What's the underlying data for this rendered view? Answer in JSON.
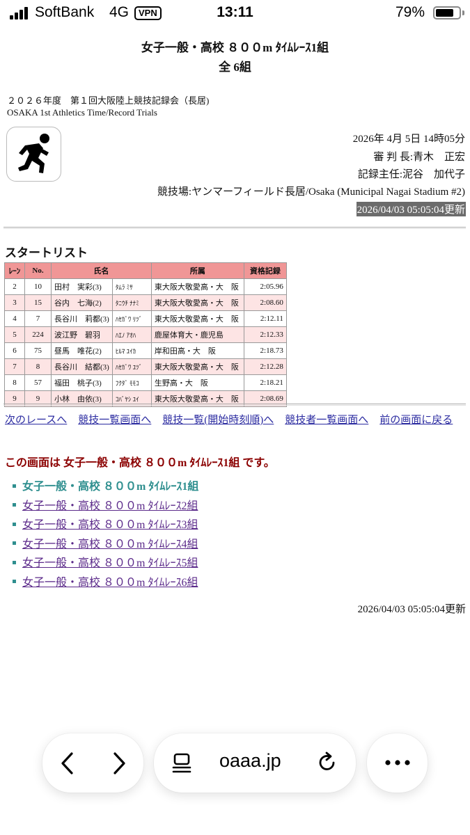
{
  "status_bar": {
    "carrier": "SoftBank",
    "network": "4G",
    "vpn": "VPN",
    "time": "13:11",
    "battery_percent": "79%",
    "battery_level": 0.79
  },
  "header": {
    "title": "女子一般・高校 ８００m ﾀｲﾑﾚｰｽ1組",
    "subtitle": "全 6組",
    "meet_name": "２０２６年度　第１回大阪陸上競技記録会（長居)",
    "meet_name_en": "OSAKA 1st Athletics Time/Record Trials"
  },
  "info": {
    "datetime": "2026年 4月 5日 14時05分",
    "referee": "審 判 長:青木　正宏",
    "recorder": "記録主任:泥谷　加代子",
    "venue": "競技場:ヤンマーフィールド長居/Osaka (Municipal Nagai Stadium #2)",
    "updated": "2026/04/03 05:05:04更新"
  },
  "section_title": "スタートリスト",
  "table": {
    "headers": {
      "lane": "ﾚｰﾝ",
      "no": "No.",
      "name": "氏名",
      "team": "所属",
      "record": "資格記録"
    },
    "rows": [
      {
        "lane": "2",
        "no": "10",
        "name": "田村　実彩(3)",
        "kana": "ﾀﾑﾗ ﾐｻ",
        "team": "東大阪大敬愛高・大　阪",
        "record": "2:05.96"
      },
      {
        "lane": "3",
        "no": "15",
        "name": "谷内　七海(2)",
        "kana": "ﾀﾆｳﾁ ﾅﾅﾐ",
        "team": "東大阪大敬愛高・大　阪",
        "record": "2:08.60"
      },
      {
        "lane": "4",
        "no": "7",
        "name": "長谷川　莉都(3)",
        "kana": "ﾊｾｶﾞﾜ ﾘﾂﾞ",
        "team": "東大阪大敬愛高・大　阪",
        "record": "2:12.11"
      },
      {
        "lane": "5",
        "no": "224",
        "name": "波江野　碧羽",
        "kana": "ﾊｴﾉ ｱｵﾊ",
        "team": "鹿屋体育大・鹿児島",
        "record": "2:12.33"
      },
      {
        "lane": "6",
        "no": "75",
        "name": "昼馬　唯花(2)",
        "kana": "ﾋﾙﾏ ﾕｲｶ",
        "team": "岸和田高・大　阪",
        "record": "2:18.73"
      },
      {
        "lane": "7",
        "no": "8",
        "name": "長谷川　結都(3)",
        "kana": "ﾊｾｶﾞﾜ ﾕﾂﾞ",
        "team": "東大阪大敬愛高・大　阪",
        "record": "2:12.28"
      },
      {
        "lane": "8",
        "no": "57",
        "name": "福田　桃子(3)",
        "kana": "ﾌｸﾀﾞ ﾓﾓｺ",
        "team": "生野高・大　阪",
        "record": "2:18.21"
      },
      {
        "lane": "9",
        "no": "9",
        "name": "小林　由依(3)",
        "kana": "ｺﾊﾞﾔｼ ﾕｲ",
        "team": "東大阪大敬愛高・大　阪",
        "record": "2:08.69"
      }
    ]
  },
  "nav_links": [
    "次のレースへ",
    "競技一覧画面へ",
    "競技一覧(開始時刻順)へ",
    "競技者一覧画面へ",
    "前の画面に戻る"
  ],
  "current_page": "この画面は 女子一般・高校 ８００m ﾀｲﾑﾚｰｽ1組 です。",
  "heats": [
    "女子一般・高校 ８００m ﾀｲﾑﾚｰｽ1組",
    "女子一般・高校 ８００m ﾀｲﾑﾚｰｽ2組",
    "女子一般・高校 ８００m ﾀｲﾑﾚｰｽ3組",
    "女子一般・高校 ８００m ﾀｲﾑﾚｰｽ4組",
    "女子一般・高校 ８００m ﾀｲﾑﾚｰｽ5組",
    "女子一般・高校 ８００m ﾀｲﾑﾚｰｽ6組"
  ],
  "footer_updated": "2026/04/03 05:05:04更新",
  "browser": {
    "address": "oaaa.jp",
    "icons": [
      "back-icon",
      "forward-icon",
      "tabs-icon",
      "reload-icon",
      "more-icon"
    ]
  }
}
